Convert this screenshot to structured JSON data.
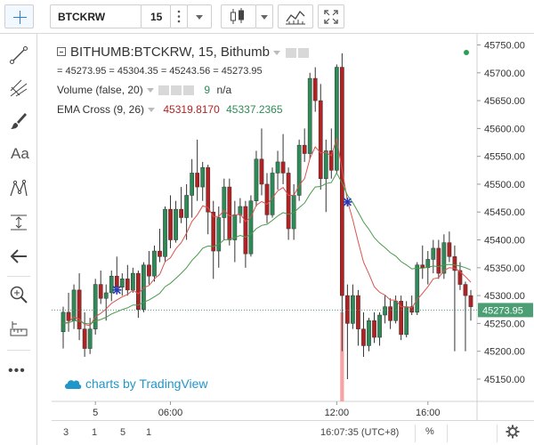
{
  "toolbar": {
    "symbol": "BTCKRW",
    "interval": "15"
  },
  "legend": {
    "title": "BITHUMB:BTCKRW, 15, Bithumb",
    "ohlc_text": "= 45273.95 = 45304.35 = 45243.56 = 45273.95",
    "volume_label": "Volume (false, 20)",
    "volume_value1": "9",
    "volume_value2": "n/a",
    "ema_label": "EMA Cross (9, 26)",
    "ema_value1": "45319.8170",
    "ema_value2": "45337.2365"
  },
  "watermark": "charts by TradingView",
  "price_axis": {
    "ticks": [
      "45750.00",
      "45700.00",
      "45650.00",
      "45600.00",
      "45550.00",
      "45500.00",
      "45450.00",
      "45400.00",
      "45350.00",
      "45300.00",
      "45250.00",
      "45200.00",
      "45150.00"
    ],
    "last_price": "45273.95"
  },
  "time_axis": {
    "ticks": [
      "5",
      "06:00",
      "12:00",
      "16:00"
    ]
  },
  "bottom_bar": {
    "ranges": [
      "3",
      "1",
      "5",
      "1"
    ],
    "clock": "16:07:35 (UTC+8)",
    "percent": "%"
  },
  "colors": {
    "up": "#2e8b57",
    "down": "#b22222",
    "ema_fast": "#d9534f",
    "ema_slow": "#4a9a4a",
    "price_tag": "#4c9e74",
    "watermark": "#2196c9"
  },
  "icons": [
    "crosshair-icon",
    "trend-line-icon",
    "pitchfork-icon",
    "brush-icon",
    "text-icon",
    "pattern-icon",
    "measure-icon",
    "back-arrow-icon",
    "zoom-icon",
    "ruler-icon",
    "more-icon",
    "candles-icon",
    "indicators-icon",
    "fullscreen-icon",
    "gear-icon",
    "cloud-icon"
  ],
  "chart_data": {
    "type": "candlestick",
    "title": "BITHUMB:BTCKRW, 15, Bithumb",
    "ylim": [
      45110,
      45770
    ],
    "y_ticks": [
      45150,
      45200,
      45250,
      45300,
      45350,
      45400,
      45450,
      45500,
      45550,
      45600,
      45650,
      45700,
      45750
    ],
    "x_ticks": [
      "5",
      "06:00",
      "12:00",
      "16:00"
    ],
    "candles": [
      [
        45235,
        45280,
        45205,
        45270
      ],
      [
        45270,
        45305,
        45235,
        45255
      ],
      [
        45255,
        45320,
        45240,
        45310
      ],
      [
        45310,
        45340,
        45220,
        45240
      ],
      [
        45240,
        45270,
        45190,
        45205
      ],
      [
        45205,
        45260,
        45195,
        45240
      ],
      [
        45240,
        45330,
        45230,
        45320
      ],
      [
        45320,
        45345,
        45285,
        45295
      ],
      [
        45295,
        45320,
        45255,
        45305
      ],
      [
        45305,
        45345,
        45290,
        45335
      ],
      [
        45335,
        45370,
        45305,
        45315
      ],
      [
        45315,
        45340,
        45300,
        45330
      ],
      [
        45330,
        45355,
        45300,
        45310
      ],
      [
        45310,
        45350,
        45305,
        45340
      ],
      [
        45340,
        45345,
        45260,
        45275
      ],
      [
        45275,
        45360,
        45270,
        45355
      ],
      [
        45355,
        45380,
        45320,
        45335
      ],
      [
        45335,
        45390,
        45325,
        45380
      ],
      [
        45380,
        45420,
        45360,
        45370
      ],
      [
        45370,
        45460,
        45360,
        45455
      ],
      [
        45455,
        45480,
        45385,
        45400
      ],
      [
        45400,
        45470,
        45395,
        45455
      ],
      [
        45455,
        45495,
        45430,
        45440
      ],
      [
        45440,
        45500,
        45400,
        45480
      ],
      [
        45480,
        45545,
        45440,
        45520
      ],
      [
        45520,
        45580,
        45470,
        45495
      ],
      [
        45495,
        45540,
        45470,
        45530
      ],
      [
        45530,
        45535,
        45410,
        45450
      ],
      [
        45450,
        45470,
        45330,
        45380
      ],
      [
        45380,
        45460,
        45350,
        45440
      ],
      [
        45440,
        45510,
        45400,
        45495
      ],
      [
        45495,
        45510,
        45390,
        45400
      ],
      [
        45400,
        45470,
        45360,
        45445
      ],
      [
        45445,
        45475,
        45430,
        45460
      ],
      [
        45460,
        45470,
        45350,
        45375
      ],
      [
        45375,
        45480,
        45370,
        45470
      ],
      [
        45470,
        45560,
        45460,
        45545
      ],
      [
        45545,
        45600,
        45480,
        45500
      ],
      [
        45500,
        45520,
        45430,
        45445
      ],
      [
        45445,
        45530,
        45440,
        45520
      ],
      [
        45520,
        45560,
        45490,
        45540
      ],
      [
        45540,
        45590,
        45500,
        45520
      ],
      [
        45520,
        45530,
        45400,
        45420
      ],
      [
        45420,
        45500,
        45400,
        45480
      ],
      [
        45480,
        45580,
        45470,
        45570
      ],
      [
        45570,
        45600,
        45540,
        45555
      ],
      [
        45555,
        45700,
        45545,
        45690
      ],
      [
        45690,
        45710,
        45630,
        45650
      ],
      [
        45650,
        45680,
        45490,
        45510
      ],
      [
        45510,
        45580,
        45450,
        45560
      ],
      [
        45560,
        45600,
        45510,
        45525
      ],
      [
        45525,
        45715,
        45520,
        45710
      ],
      [
        45710,
        45735,
        45200,
        45300
      ],
      [
        45300,
        45320,
        45150,
        45250
      ],
      [
        45250,
        45320,
        45240,
        45300
      ],
      [
        45300,
        45310,
        45210,
        45240
      ],
      [
        45240,
        45270,
        45190,
        45210
      ],
      [
        45210,
        45260,
        45200,
        45255
      ],
      [
        45255,
        45270,
        45215,
        45225
      ],
      [
        45225,
        45270,
        45210,
        45265
      ],
      [
        45265,
        45300,
        45250,
        45280
      ],
      [
        45280,
        45295,
        45240,
        45255
      ],
      [
        45255,
        45300,
        45250,
        45290
      ],
      [
        45290,
        45300,
        45220,
        45230
      ],
      [
        45230,
        45290,
        45225,
        45280
      ],
      [
        45280,
        45300,
        45265,
        45270
      ],
      [
        45270,
        45360,
        45265,
        45355
      ],
      [
        45355,
        45390,
        45330,
        45350
      ],
      [
        45350,
        45380,
        45320,
        45365
      ],
      [
        45365,
        45400,
        45340,
        45385
      ],
      [
        45385,
        45400,
        45330,
        45340
      ],
      [
        45340,
        45410,
        45330,
        45395
      ],
      [
        45395,
        45415,
        45360,
        45370
      ],
      [
        45370,
        45390,
        45200,
        45345
      ],
      [
        45345,
        45360,
        45310,
        45320
      ],
      [
        45320,
        45325,
        45200,
        45300
      ],
      [
        45300,
        45310,
        45255,
        45280
      ]
    ],
    "series": [
      {
        "name": "EMA 9",
        "values": [
          45250,
          45252,
          45262,
          45258,
          45248,
          45246,
          45262,
          45268,
          45276,
          45286,
          45292,
          45298,
          45302,
          45310,
          45303,
          45314,
          45318,
          45330,
          45338,
          45361,
          45368,
          45384,
          45395,
          45412,
          45433,
          45445,
          45461,
          45458,
          45442,
          45442,
          45453,
          45443,
          45444,
          45447,
          45433,
          45441,
          45462,
          45469,
          45464,
          45475,
          45488,
          45494,
          45480,
          45480,
          45498,
          45510,
          45546,
          45567,
          45556,
          45557,
          45551,
          45582,
          45526,
          45470,
          45436,
          45397,
          45360,
          45339,
          45316,
          45306,
          45301,
          45292,
          45292,
          45280,
          45280,
          45278,
          45293,
          45304,
          45316,
          45330,
          45332,
          45345,
          45350,
          45349,
          45343,
          45334,
          45324
        ]
      },
      {
        "name": "EMA 26",
        "values": [
          45250,
          45251,
          45255,
          45254,
          45250,
          45249,
          45254,
          45257,
          45261,
          45267,
          45271,
          45275,
          45278,
          45283,
          45283,
          45288,
          45292,
          45298,
          45304,
          45316,
          45322,
          45331,
          45340,
          45350,
          45363,
          45373,
          45385,
          45389,
          45388,
          45392,
          45400,
          45401,
          45404,
          45408,
          45405,
          45410,
          45420,
          45426,
          45428,
          45435,
          45443,
          45449,
          45446,
          45449,
          45458,
          45466,
          45482,
          45495,
          45496,
          45501,
          45503,
          45520,
          45502,
          45480,
          45467,
          45450,
          45432,
          45419,
          45404,
          45394,
          45386,
          45377,
          45371,
          45361,
          45355,
          45348,
          45349,
          45349,
          45351,
          45353,
          45352,
          45355,
          45356,
          45355,
          45353,
          45350,
          45346
        ]
      }
    ]
  }
}
